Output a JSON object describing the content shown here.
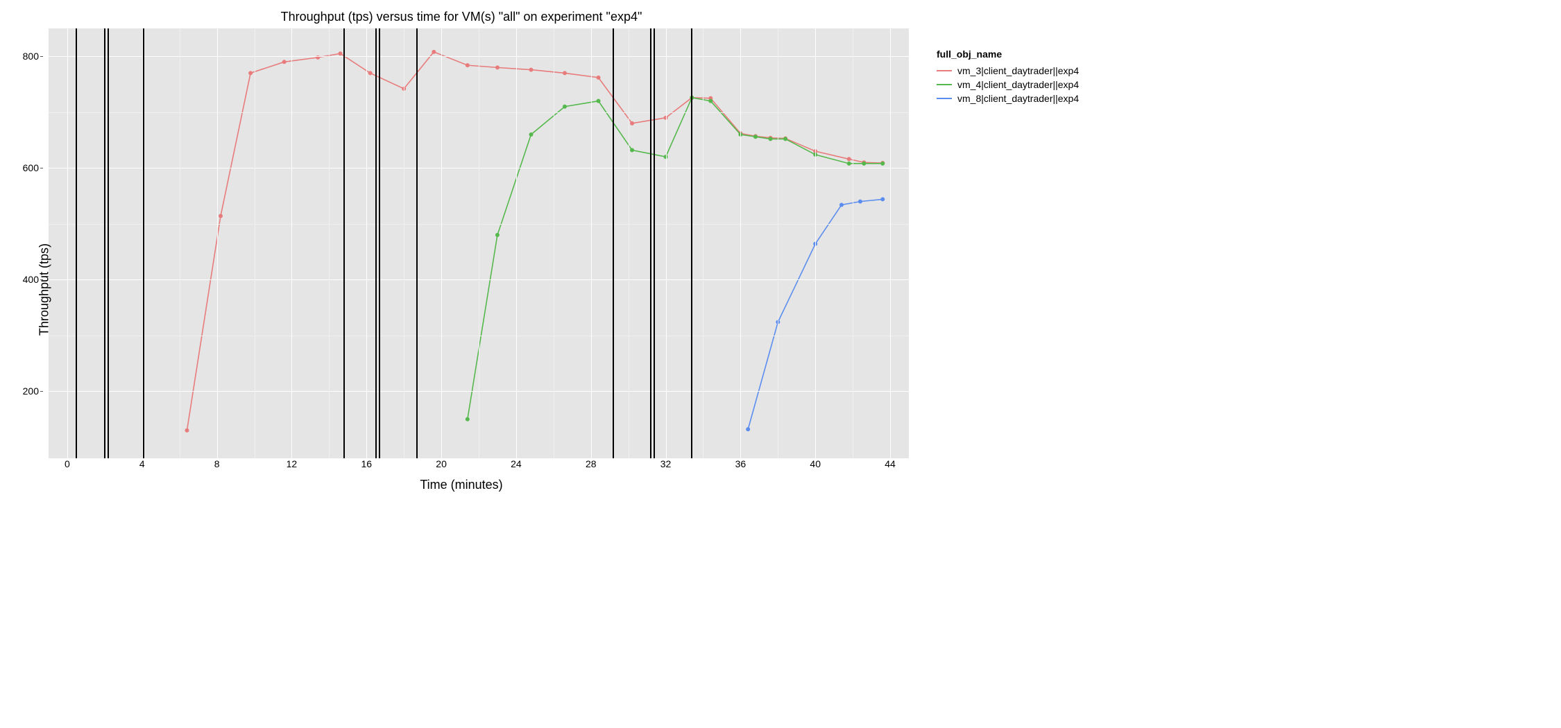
{
  "chart_data": {
    "type": "line",
    "title": "Throughput (tps) versus time for VM(s) \"all\" on experiment \"exp4\"",
    "xlabel": "Time (minutes)",
    "ylabel": "Throughput (tps)",
    "xlim": [
      -1,
      45
    ],
    "ylim": [
      80,
      850
    ],
    "xticks": [
      0,
      4,
      8,
      12,
      16,
      20,
      24,
      28,
      32,
      36,
      40,
      44
    ],
    "yticks": [
      200,
      400,
      600,
      800
    ],
    "legend_title": "full_obj_name",
    "series": [
      {
        "name": "vm_3|client_daytrader||exp4",
        "color": "#e87b7b",
        "points": [
          [
            6.4,
            130
          ],
          [
            8.2,
            514
          ],
          [
            9.8,
            770
          ],
          [
            11.6,
            790
          ],
          [
            13.4,
            798
          ],
          [
            14.6,
            805
          ],
          [
            16.2,
            770
          ],
          [
            18.0,
            742
          ],
          [
            19.6,
            808
          ],
          [
            21.4,
            784
          ],
          [
            23.0,
            780
          ],
          [
            24.8,
            776
          ],
          [
            26.6,
            770
          ],
          [
            28.4,
            762
          ],
          [
            30.2,
            680
          ],
          [
            32.0,
            690
          ],
          [
            33.4,
            726
          ],
          [
            34.4,
            725
          ],
          [
            36.0,
            662
          ],
          [
            36.8,
            657
          ],
          [
            37.6,
            654
          ],
          [
            38.4,
            653
          ],
          [
            40.0,
            630
          ],
          [
            41.8,
            616
          ],
          [
            42.6,
            610
          ],
          [
            43.6,
            609
          ]
        ]
      },
      {
        "name": "vm_4|client_daytrader||exp4",
        "color": "#55b84c",
        "points": [
          [
            21.4,
            150
          ],
          [
            23.0,
            480
          ],
          [
            24.8,
            660
          ],
          [
            26.6,
            710
          ],
          [
            28.4,
            720
          ],
          [
            30.2,
            632
          ],
          [
            32.0,
            620
          ],
          [
            33.4,
            726
          ],
          [
            34.4,
            720
          ],
          [
            36.0,
            660
          ],
          [
            36.8,
            656
          ],
          [
            37.6,
            652
          ],
          [
            38.4,
            652
          ],
          [
            40.0,
            624
          ],
          [
            41.8,
            608
          ],
          [
            42.6,
            608
          ],
          [
            43.6,
            608
          ]
        ]
      },
      {
        "name": "vm_8|client_daytrader||exp4",
        "color": "#5b8def",
        "points": [
          [
            36.4,
            132
          ],
          [
            38.0,
            324
          ],
          [
            40.0,
            464
          ],
          [
            41.4,
            534
          ],
          [
            42.4,
            540
          ],
          [
            43.6,
            544
          ]
        ]
      }
    ],
    "vlines_solid": [
      2.0,
      2.2,
      4.1,
      16.5,
      16.7,
      18.7,
      31.2,
      31.4,
      33.4
    ],
    "vlines_dashed": [
      0.5,
      14.8,
      29.2
    ]
  }
}
